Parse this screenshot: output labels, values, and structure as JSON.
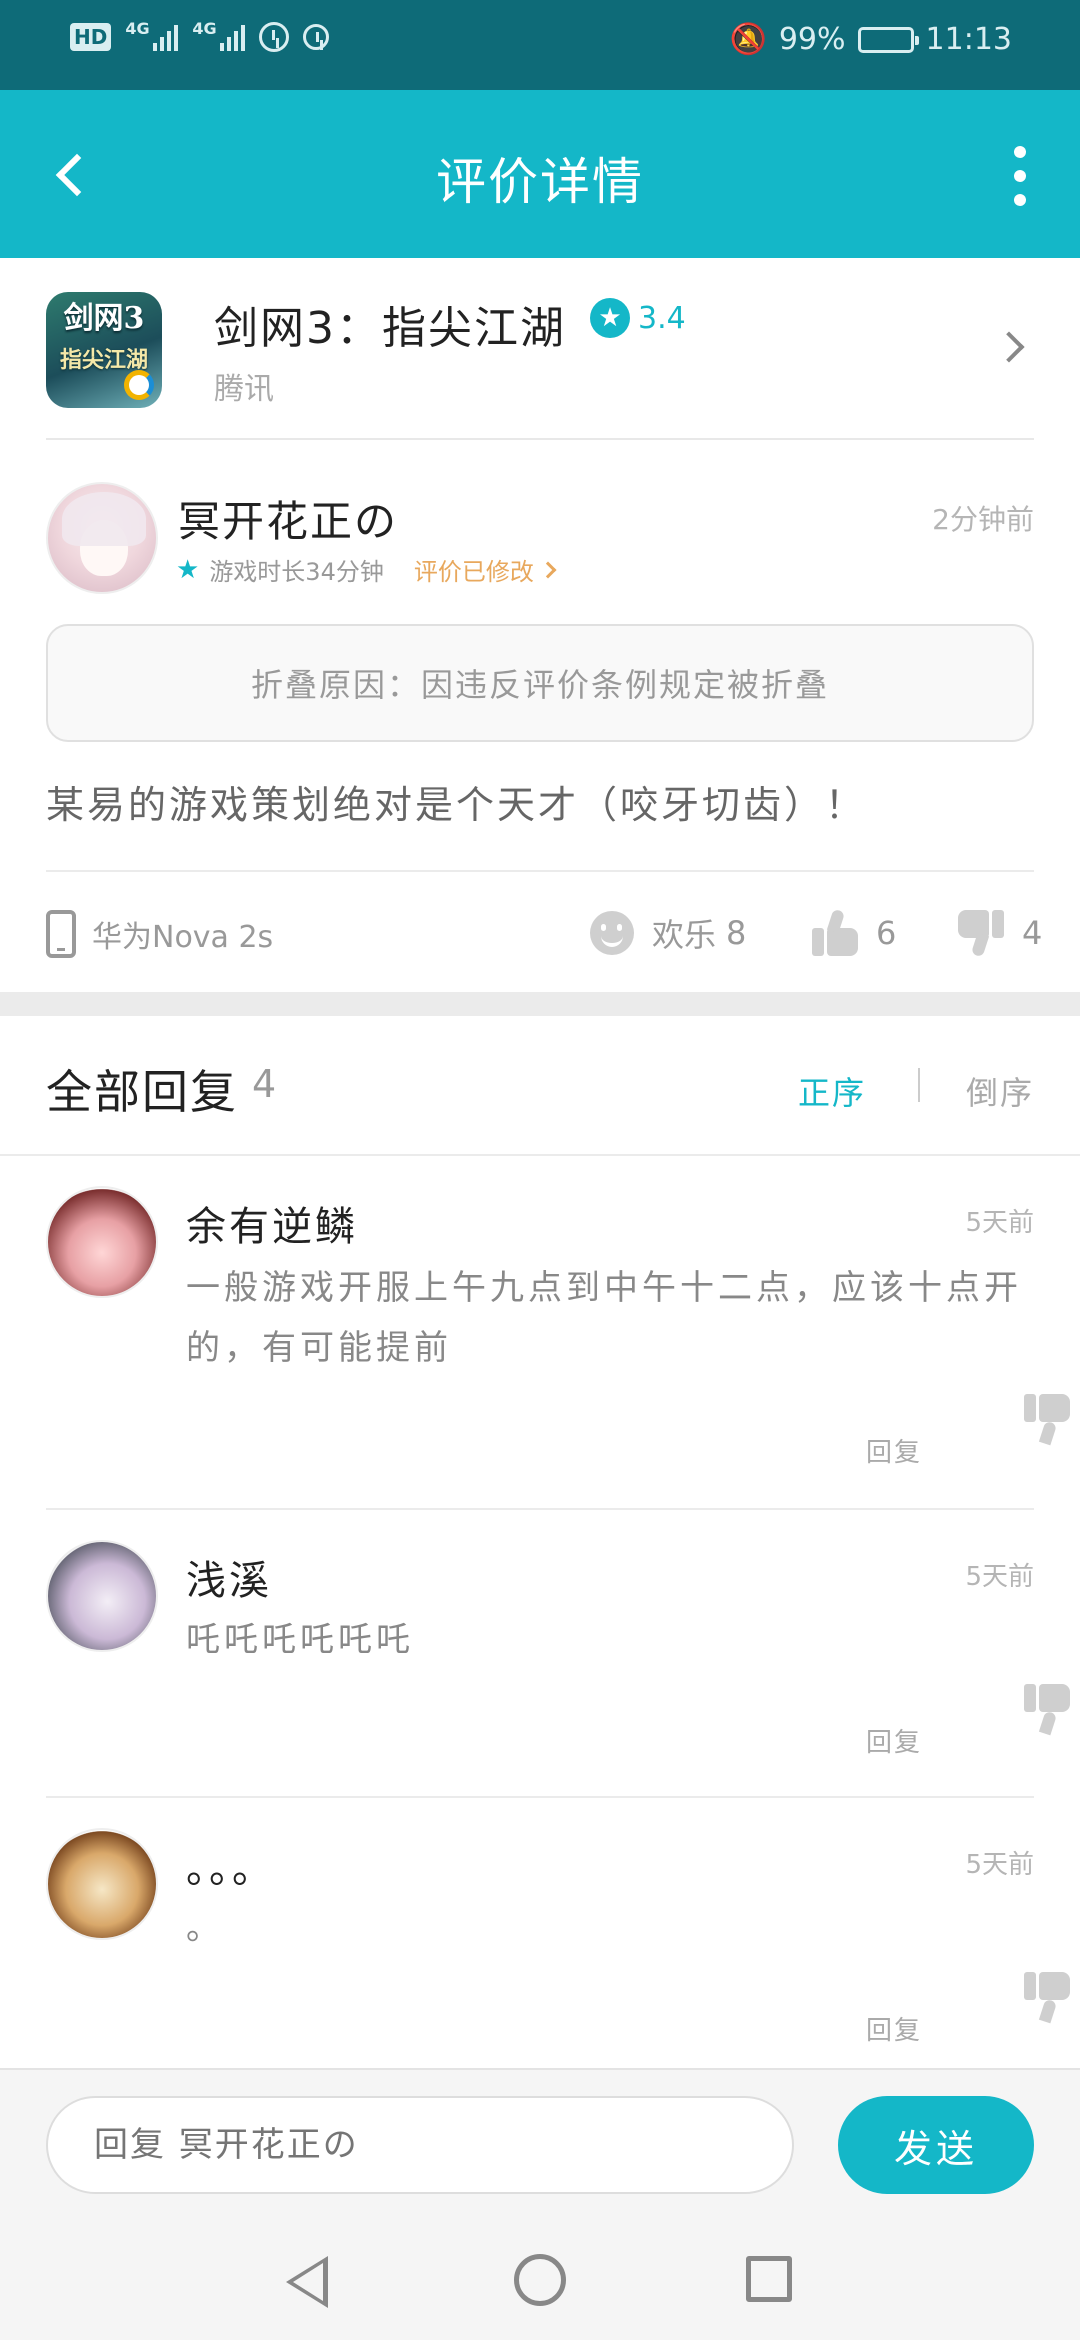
{
  "status_bar": {
    "hd": "HD",
    "net1": "4G",
    "net2": "4G",
    "battery": "99%",
    "time": "11:13"
  },
  "app_bar": {
    "title": "评价详情"
  },
  "game": {
    "logo_text": "剑网3",
    "logo_sub": "指尖江湖",
    "name": "剑网3：指尖江湖",
    "rating": "3.4",
    "publisher": "腾讯"
  },
  "review": {
    "author": "冥开花正の",
    "time": "2分钟前",
    "play_time": "游戏时长34分钟",
    "edited": "评价已修改",
    "fold_reason": "折叠原因：因违反评价条例规定被折叠",
    "content": "某易的游戏策划绝对是个天才（咬牙切齿）！",
    "device": "华为Nova 2s",
    "funny_label": "欢乐",
    "funny_count": "8",
    "likes": "6",
    "dislikes": "4"
  },
  "replies_header": {
    "title": "全部回复",
    "count": "4",
    "sort_asc": "正序",
    "sort_desc": "倒序"
  },
  "replies": [
    {
      "author": "余有逆鳞",
      "time": "5天前",
      "content": "一般游戏开服上午九点到中午十二点，应该十点开的，有可能提前",
      "reply_label": "回复"
    },
    {
      "author": "浅溪",
      "time": "5天前",
      "content": "吒吒吒吒吒吒",
      "reply_label": "回复"
    },
    {
      "author": "。。。",
      "time": "5天前",
      "content": "。",
      "reply_label": "回复"
    }
  ],
  "input": {
    "placeholder": "回复 冥开花正の",
    "send_label": "发送"
  },
  "colors": {
    "accent": "#14b7c8",
    "status_bar": "#0e6b78",
    "edited": "#e8a85d"
  },
  "icons": [
    "back-arrow-icon",
    "more-vertical-icon",
    "star-icon",
    "chevron-right-icon",
    "phone-icon",
    "smile-icon",
    "thumb-up-icon",
    "thumb-down-icon",
    "nav-back-icon",
    "nav-home-icon",
    "nav-recent-icon"
  ]
}
